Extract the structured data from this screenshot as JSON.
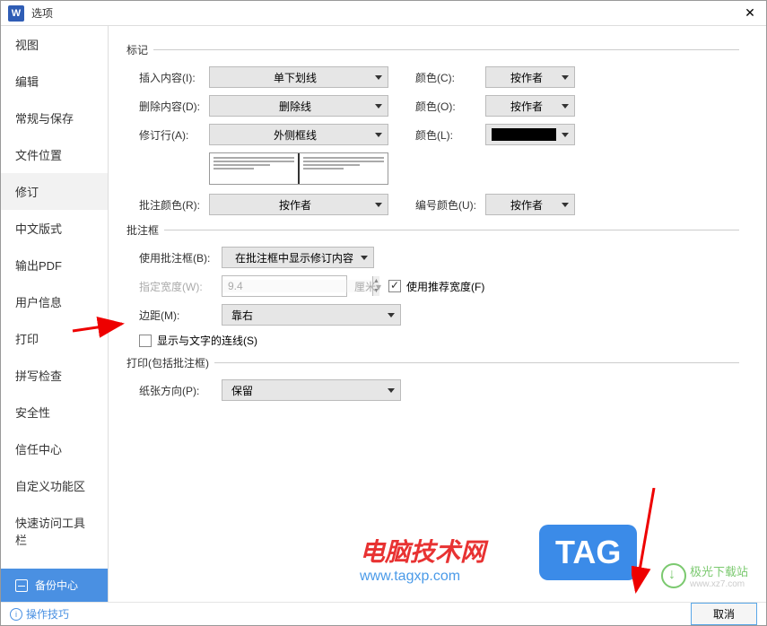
{
  "window": {
    "app_icon_letter": "W",
    "title": "选项"
  },
  "sidebar": {
    "items": [
      {
        "label": "视图"
      },
      {
        "label": "编辑"
      },
      {
        "label": "常规与保存"
      },
      {
        "label": "文件位置"
      },
      {
        "label": "修订"
      },
      {
        "label": "中文版式"
      },
      {
        "label": "输出PDF"
      },
      {
        "label": "用户信息"
      },
      {
        "label": "打印"
      },
      {
        "label": "拼写检查"
      },
      {
        "label": "安全性"
      },
      {
        "label": "信任中心"
      },
      {
        "label": "自定义功能区"
      },
      {
        "label": "快速访问工具栏"
      }
    ],
    "active_index": 4,
    "backup_label": "备份中心"
  },
  "sections": {
    "mark": {
      "title": "标记",
      "insert_label": "插入内容(I):",
      "insert_value": "单下划线",
      "delete_label": "删除内容(D):",
      "delete_value": "删除线",
      "revise_label": "修订行(A):",
      "revise_value": "外侧框线",
      "color_c_label": "颜色(C):",
      "color_o_label": "颜色(O):",
      "color_l_label": "颜色(L):",
      "by_author": "按作者",
      "comment_color_label": "批注颜色(R):",
      "number_color_label": "编号颜色(U):"
    },
    "comment_box": {
      "title": "批注框",
      "use_label": "使用批注框(B):",
      "use_value": "在批注框中显示修订内容",
      "width_label": "指定宽度(W):",
      "width_value": "9.4",
      "width_unit": "厘米▾",
      "rec_width_label": "使用推荐宽度(F)",
      "margin_label": "边距(M):",
      "margin_value": "靠右",
      "show_line_label": "显示与文字的连线(S)"
    },
    "print": {
      "title": "打印(包括批注框)",
      "orient_label": "纸张方向(P):",
      "orient_value": "保留"
    }
  },
  "footer": {
    "tips_label": "操作技巧",
    "cancel_label": "取消"
  },
  "watermarks": {
    "red_text": "电脑技术网",
    "red_url": "www.tagxp.com",
    "tag_text": "TAG",
    "green_text": "极光下载站",
    "green_url": "www.xz7.com"
  }
}
